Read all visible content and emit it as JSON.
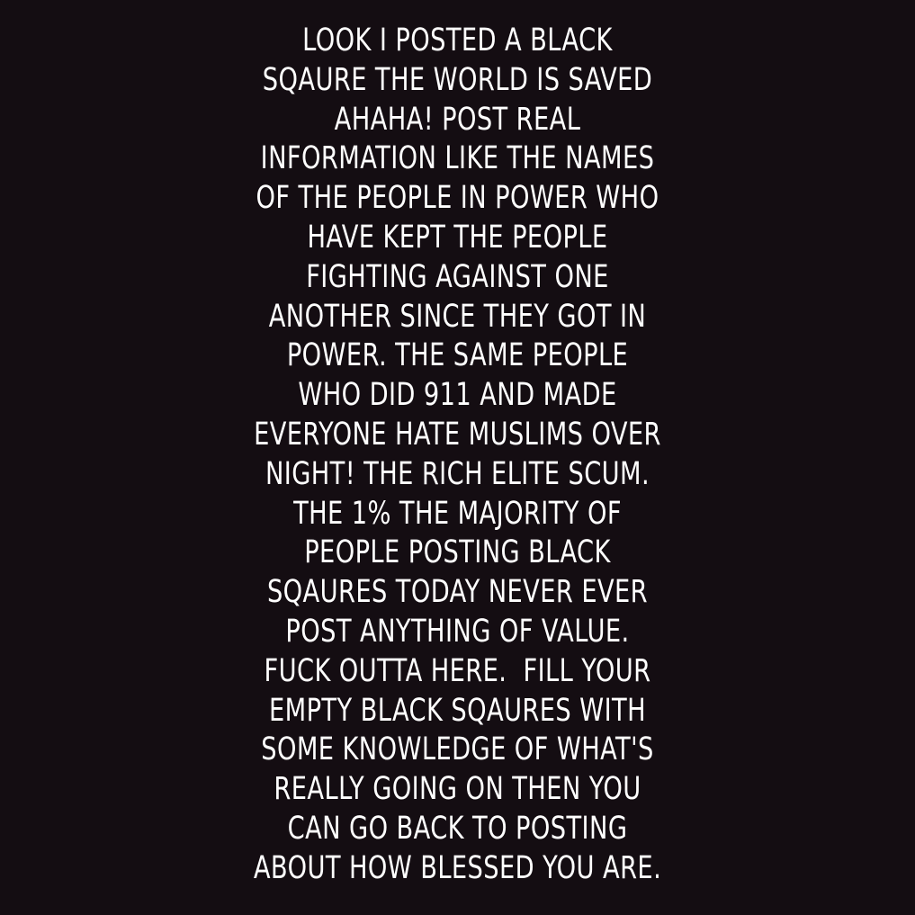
{
  "colors": {
    "background": "#140d12",
    "text": "#ffffff"
  },
  "post": {
    "lines": [
      "LOOK I POSTED A BLACK",
      "SQAURE THE WORLD IS SAVED",
      "AHAHA! POST REAL",
      "INFORMATION LIKE THE NAMES",
      "OF THE PEOPLE IN POWER WHO",
      "HAVE KEPT THE PEOPLE",
      "FIGHTING AGAINST ONE",
      "ANOTHER SINCE THEY GOT IN",
      "POWER. THE SAME PEOPLE",
      "WHO DID 911 AND MADE",
      "EVERYONE HATE MUSLIMS OVER",
      "NIGHT! THE RICH ELITE SCUM.",
      "THE 1% THE MAJORITY OF",
      "PEOPLE POSTING BLACK",
      "SQAURES TODAY NEVER EVER",
      "POST ANYTHING OF VALUE.",
      "FUCK OUTTA HERE.  FILL YOUR",
      "EMPTY BLACK SQAURES WITH",
      "SOME KNOWLEDGE OF WHAT'S",
      "REALLY GOING ON THEN YOU",
      "CAN GO BACK TO POSTING",
      "ABOUT HOW BLESSED YOU ARE."
    ]
  }
}
